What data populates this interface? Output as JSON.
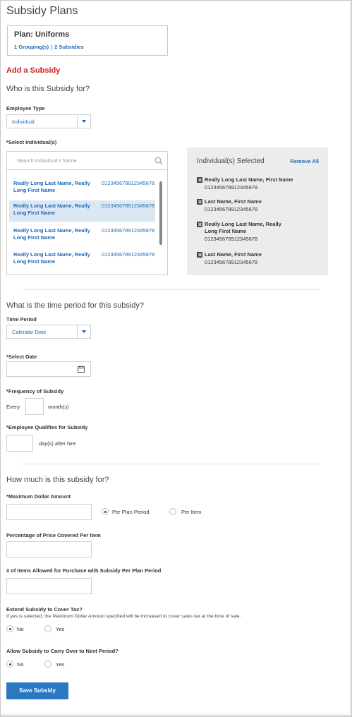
{
  "page": {
    "title": "Subsidy Plans"
  },
  "plan": {
    "name": "Plan: Uniforms",
    "groupings": "1 Grouping(s)",
    "separator": "|",
    "subsidies": "2 Subsidies"
  },
  "add": {
    "title": "Add a Subsidy"
  },
  "who": {
    "question": "Who is this Subsidy for?",
    "employee_type_label": "Employee Type",
    "employee_type_value": "Individual",
    "select_individuals_label": "*Select Individual(s)",
    "search_placeholder": "Search Individual's Name",
    "individuals": [
      {
        "name": "Really Long Last Name, Really Long First Name",
        "id": "012345678912345678",
        "selected": false
      },
      {
        "name": "Really Long Last Name, Really Long First Name",
        "id": "012345678912345678",
        "selected": true
      },
      {
        "name": "Really Long Last Name, Really Long First Name",
        "id": "012345678912345678",
        "selected": false
      },
      {
        "name": "Really Long Last Name, Really Long First Name",
        "id": "012345678912345678",
        "selected": false
      }
    ],
    "selected_panel": {
      "title": "Individual(s) Selected",
      "remove_all": "Remove All",
      "items": [
        {
          "name": "Really Long Last Name, First Name",
          "id": "012345678912345678"
        },
        {
          "name": "Last Name, First Name",
          "id": "012345678912345678"
        },
        {
          "name": "Really Long Last Name, Really Long First Name",
          "id": "012345678912345678"
        },
        {
          "name": "Last Name, First Name",
          "id": "012345678912345678"
        }
      ]
    }
  },
  "time": {
    "question": "What is the time period for this subsidy?",
    "period_label": "Time Period",
    "period_value": "Calendar Date",
    "select_date_label": "*Select Date",
    "date_value": "",
    "frequency_label": "*Frequency of Subsidy",
    "frequency_prefix": "Every",
    "frequency_value": "",
    "frequency_suffix": "month(s)",
    "qualifies_label": "*Employee Qualifies for Subsidy",
    "qualifies_value": "",
    "qualifies_suffix": "day(s) after hire"
  },
  "amount": {
    "question": "How much is this subsidy for?",
    "max_label": "*Maximum Dollar Amount",
    "max_value": "",
    "per_plan_period": "Per Plan Period",
    "per_item": "Per Item",
    "percentage_label": "Percentage of Price Covered Per Item",
    "percentage_value": "",
    "items_label": "# of Items Allowed for Purchase with Subsidy Per Plan Period",
    "items_value": "",
    "tax_label": "Extend Subsidy to Cover Tax?",
    "tax_help": "If yes is selected, the Maximum Dollar Amount specified will be increased to cover sales tax at the time of sale.",
    "tax_no": "No",
    "tax_yes": "Yes",
    "carry_label": "Allow Subsidy to Carry Over to Next Period?",
    "carry_no": "No",
    "carry_yes": "Yes"
  },
  "actions": {
    "save": "Save Subsidy"
  },
  "colors": {
    "link": "#1e6bb8",
    "accent_red": "#cc2222",
    "button": "#2a77c2",
    "selected_row": "#dbe7f2",
    "panel_bg": "#ececec"
  }
}
